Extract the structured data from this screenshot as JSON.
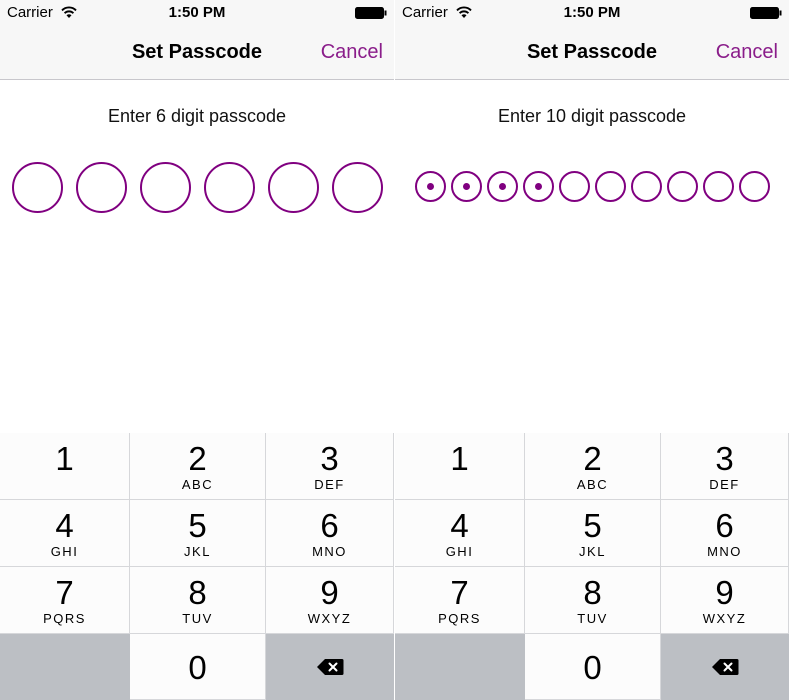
{
  "status_bar": {
    "carrier": "Carrier",
    "time": "1:50 PM",
    "wifi_icon": "wifi-icon",
    "battery_icon": "battery-icon"
  },
  "nav": {
    "title": "Set Passcode",
    "cancel_label": "Cancel"
  },
  "colors": {
    "accent": "#800080",
    "cancel_text": "#8a1d8a",
    "bar_background": "#f7f7f7",
    "function_key_background": "#bcbfc4"
  },
  "left_screen": {
    "prompt": "Enter 6 digit passcode",
    "digits_total": 6,
    "digits_entered": 0
  },
  "right_screen": {
    "prompt": "Enter 10 digit passcode",
    "digits_total": 10,
    "digits_entered": 4
  },
  "keypad": {
    "keys": [
      {
        "num": "1",
        "letters": ""
      },
      {
        "num": "2",
        "letters": "ABC"
      },
      {
        "num": "3",
        "letters": "DEF"
      },
      {
        "num": "4",
        "letters": "GHI"
      },
      {
        "num": "5",
        "letters": "JKL"
      },
      {
        "num": "6",
        "letters": "MNO"
      },
      {
        "num": "7",
        "letters": "PQRS"
      },
      {
        "num": "8",
        "letters": "TUV"
      },
      {
        "num": "9",
        "letters": "WXYZ"
      }
    ],
    "zero": "0",
    "delete_icon": "backspace-icon"
  }
}
